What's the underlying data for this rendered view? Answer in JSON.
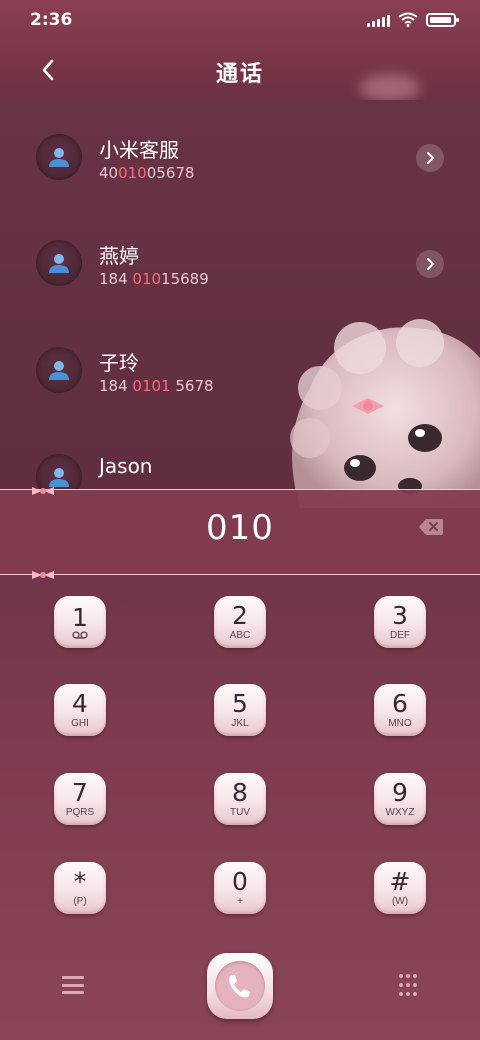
{
  "status_bar": {
    "time": "2:36"
  },
  "header": {
    "title": "通话",
    "back_icon": "chevron-left-icon"
  },
  "contacts": [
    {
      "name": "小米客服",
      "number_pre": "40",
      "number_match": "010",
      "number_post": "05678"
    },
    {
      "name": "燕婷",
      "number_pre": "184 ",
      "number_match": "010",
      "number_post": "15689"
    },
    {
      "name": "子玲",
      "number_pre": "184 ",
      "number_match": "0101",
      "number_post": " 5678"
    },
    {
      "name": "Jason",
      "number_pre": "",
      "number_match": "",
      "number_post": ""
    }
  ],
  "dialer": {
    "digits": "010"
  },
  "keypad": [
    {
      "num": "1",
      "sub": "voicemail"
    },
    {
      "num": "2",
      "sub": "ABC"
    },
    {
      "num": "3",
      "sub": "DEF"
    },
    {
      "num": "4",
      "sub": "GHI"
    },
    {
      "num": "5",
      "sub": "JKL"
    },
    {
      "num": "6",
      "sub": "MNO"
    },
    {
      "num": "7",
      "sub": "PQRS"
    },
    {
      "num": "8",
      "sub": "TUV"
    },
    {
      "num": "9",
      "sub": "WXYZ"
    },
    {
      "num": "*",
      "sub": "(P)"
    },
    {
      "num": "0",
      "sub": "+"
    },
    {
      "num": "#",
      "sub": "(W)"
    }
  ],
  "colors": {
    "accent_highlight": "#ff6a7a",
    "background": "#6e3446",
    "key_face": "#f6e4e8"
  }
}
